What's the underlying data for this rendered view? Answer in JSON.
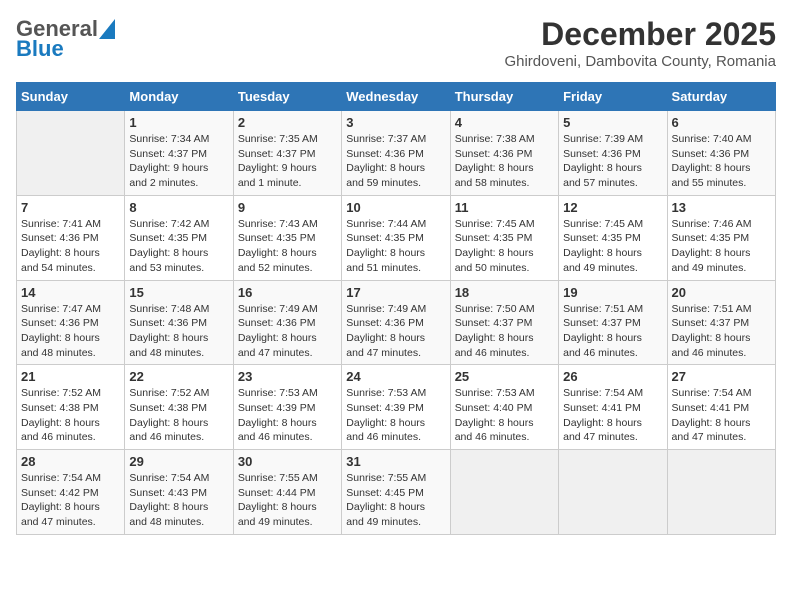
{
  "header": {
    "logo": {
      "general": "General",
      "blue": "Blue"
    },
    "title": "December 2025",
    "subtitle": "Ghirdoveni, Dambovita County, Romania"
  },
  "weekdays": [
    "Sunday",
    "Monday",
    "Tuesday",
    "Wednesday",
    "Thursday",
    "Friday",
    "Saturday"
  ],
  "weeks": [
    [
      {
        "day": "",
        "info": ""
      },
      {
        "day": "1",
        "info": "Sunrise: 7:34 AM\nSunset: 4:37 PM\nDaylight: 9 hours\nand 2 minutes."
      },
      {
        "day": "2",
        "info": "Sunrise: 7:35 AM\nSunset: 4:37 PM\nDaylight: 9 hours\nand 1 minute."
      },
      {
        "day": "3",
        "info": "Sunrise: 7:37 AM\nSunset: 4:36 PM\nDaylight: 8 hours\nand 59 minutes."
      },
      {
        "day": "4",
        "info": "Sunrise: 7:38 AM\nSunset: 4:36 PM\nDaylight: 8 hours\nand 58 minutes."
      },
      {
        "day": "5",
        "info": "Sunrise: 7:39 AM\nSunset: 4:36 PM\nDaylight: 8 hours\nand 57 minutes."
      },
      {
        "day": "6",
        "info": "Sunrise: 7:40 AM\nSunset: 4:36 PM\nDaylight: 8 hours\nand 55 minutes."
      }
    ],
    [
      {
        "day": "7",
        "info": "Sunrise: 7:41 AM\nSunset: 4:36 PM\nDaylight: 8 hours\nand 54 minutes."
      },
      {
        "day": "8",
        "info": "Sunrise: 7:42 AM\nSunset: 4:35 PM\nDaylight: 8 hours\nand 53 minutes."
      },
      {
        "day": "9",
        "info": "Sunrise: 7:43 AM\nSunset: 4:35 PM\nDaylight: 8 hours\nand 52 minutes."
      },
      {
        "day": "10",
        "info": "Sunrise: 7:44 AM\nSunset: 4:35 PM\nDaylight: 8 hours\nand 51 minutes."
      },
      {
        "day": "11",
        "info": "Sunrise: 7:45 AM\nSunset: 4:35 PM\nDaylight: 8 hours\nand 50 minutes."
      },
      {
        "day": "12",
        "info": "Sunrise: 7:45 AM\nSunset: 4:35 PM\nDaylight: 8 hours\nand 49 minutes."
      },
      {
        "day": "13",
        "info": "Sunrise: 7:46 AM\nSunset: 4:35 PM\nDaylight: 8 hours\nand 49 minutes."
      }
    ],
    [
      {
        "day": "14",
        "info": "Sunrise: 7:47 AM\nSunset: 4:36 PM\nDaylight: 8 hours\nand 48 minutes."
      },
      {
        "day": "15",
        "info": "Sunrise: 7:48 AM\nSunset: 4:36 PM\nDaylight: 8 hours\nand 48 minutes."
      },
      {
        "day": "16",
        "info": "Sunrise: 7:49 AM\nSunset: 4:36 PM\nDaylight: 8 hours\nand 47 minutes."
      },
      {
        "day": "17",
        "info": "Sunrise: 7:49 AM\nSunset: 4:36 PM\nDaylight: 8 hours\nand 47 minutes."
      },
      {
        "day": "18",
        "info": "Sunrise: 7:50 AM\nSunset: 4:37 PM\nDaylight: 8 hours\nand 46 minutes."
      },
      {
        "day": "19",
        "info": "Sunrise: 7:51 AM\nSunset: 4:37 PM\nDaylight: 8 hours\nand 46 minutes."
      },
      {
        "day": "20",
        "info": "Sunrise: 7:51 AM\nSunset: 4:37 PM\nDaylight: 8 hours\nand 46 minutes."
      }
    ],
    [
      {
        "day": "21",
        "info": "Sunrise: 7:52 AM\nSunset: 4:38 PM\nDaylight: 8 hours\nand 46 minutes."
      },
      {
        "day": "22",
        "info": "Sunrise: 7:52 AM\nSunset: 4:38 PM\nDaylight: 8 hours\nand 46 minutes."
      },
      {
        "day": "23",
        "info": "Sunrise: 7:53 AM\nSunset: 4:39 PM\nDaylight: 8 hours\nand 46 minutes."
      },
      {
        "day": "24",
        "info": "Sunrise: 7:53 AM\nSunset: 4:39 PM\nDaylight: 8 hours\nand 46 minutes."
      },
      {
        "day": "25",
        "info": "Sunrise: 7:53 AM\nSunset: 4:40 PM\nDaylight: 8 hours\nand 46 minutes."
      },
      {
        "day": "26",
        "info": "Sunrise: 7:54 AM\nSunset: 4:41 PM\nDaylight: 8 hours\nand 47 minutes."
      },
      {
        "day": "27",
        "info": "Sunrise: 7:54 AM\nSunset: 4:41 PM\nDaylight: 8 hours\nand 47 minutes."
      }
    ],
    [
      {
        "day": "28",
        "info": "Sunrise: 7:54 AM\nSunset: 4:42 PM\nDaylight: 8 hours\nand 47 minutes."
      },
      {
        "day": "29",
        "info": "Sunrise: 7:54 AM\nSunset: 4:43 PM\nDaylight: 8 hours\nand 48 minutes."
      },
      {
        "day": "30",
        "info": "Sunrise: 7:55 AM\nSunset: 4:44 PM\nDaylight: 8 hours\nand 49 minutes."
      },
      {
        "day": "31",
        "info": "Sunrise: 7:55 AM\nSunset: 4:45 PM\nDaylight: 8 hours\nand 49 minutes."
      },
      {
        "day": "",
        "info": ""
      },
      {
        "day": "",
        "info": ""
      },
      {
        "day": "",
        "info": ""
      }
    ]
  ]
}
